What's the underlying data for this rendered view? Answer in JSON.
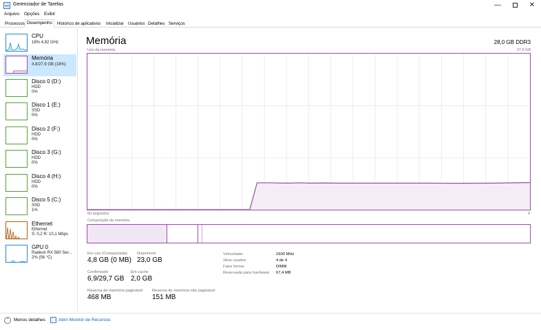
{
  "window": {
    "title": "Gerenciador de Tarefas",
    "minimize": "—",
    "close": "✕"
  },
  "menu": [
    "Arquivo",
    "Opções",
    "Exibir"
  ],
  "tabs": [
    {
      "label": "Processos",
      "active": false
    },
    {
      "label": "Desempenho",
      "active": true
    },
    {
      "label": "Histórico de aplicativos",
      "active": false
    },
    {
      "label": "Inicializar",
      "active": false
    },
    {
      "label": "Usuários",
      "active": false
    },
    {
      "label": "Detalhes",
      "active": false
    },
    {
      "label": "Serviços",
      "active": false
    }
  ],
  "sidebar": [
    {
      "title": "CPU",
      "sub": [
        "18% 4,82 GHz"
      ],
      "color": "#1f8ad6"
    },
    {
      "title": "Memória",
      "sub": [
        "4,8/27,9 GB (18%)"
      ],
      "color": "#9b4aa8"
    },
    {
      "title": "Disco 0 (D:)",
      "sub": [
        "HDD",
        "0%"
      ],
      "color": "#4ca52f"
    },
    {
      "title": "Disco 1 (E:)",
      "sub": [
        "SSD",
        "0%"
      ],
      "color": "#4ca52f"
    },
    {
      "title": "Disco 2 (F:)",
      "sub": [
        "HDD",
        "0%"
      ],
      "color": "#4ca52f"
    },
    {
      "title": "Disco 3 (G:)",
      "sub": [
        "HDD",
        "0%"
      ],
      "color": "#4ca52f"
    },
    {
      "title": "Disco 4 (H:)",
      "sub": [
        "HDD",
        "0%"
      ],
      "color": "#4ca52f"
    },
    {
      "title": "Disco 5 (C:)",
      "sub": [
        "SSD",
        "1%"
      ],
      "color": "#4ca52f"
    },
    {
      "title": "Ethernet",
      "sub": [
        "Ethernet",
        "S: 0,2 R: 10,1 Mbps"
      ],
      "color": "#a65f10"
    },
    {
      "title": "GPU 0",
      "sub": [
        "Radeon RX 580 Ser...",
        "2% (56 °C)"
      ],
      "color": "#1f8ad6"
    }
  ],
  "main": {
    "title": "Memória",
    "capacity": "28,0 GB DDR3",
    "chart_label": "Uso da memória",
    "chart_max": "27,9 GB",
    "time_left": "60 segundos",
    "time_right": "0",
    "composition_label": "Composição da memória"
  },
  "chart_data": {
    "type": "area",
    "title": "Uso da memória",
    "x_label_left": "60 segundos",
    "x_label_right": "0",
    "y_max_label": "27,9 GB",
    "ylim": [
      0,
      27.9
    ],
    "grid": true,
    "color": "#9b4aa8",
    "series": [
      {
        "x": [
          60,
          38,
          37,
          35,
          33,
          31,
          30,
          28,
          26,
          20,
          14,
          10,
          5,
          0
        ],
        "values": [
          0,
          0,
          4.8,
          4.8,
          4.75,
          4.8,
          4.75,
          4.78,
          4.75,
          4.75,
          4.75,
          4.72,
          4.75,
          4.85
        ]
      }
    ]
  },
  "composition": {
    "in_use_fraction": 0.18,
    "modified_fraction": 0.07,
    "standby_fraction": 0.01
  },
  "stats": {
    "in_use_label": "Em uso (Compactada)",
    "in_use_value": "4,8 GB (0 MB)",
    "available_label": "Disponível",
    "available_value": "23,0 GB",
    "committed_label": "Confirmado",
    "committed_value": "6,9/29,7 GB",
    "cached_label": "Em cache",
    "cached_value": "2,0 GB",
    "paged_label": "Reserva de memória paginável",
    "paged_value": "468 MB",
    "nonpaged_label": "Reserva de memória não paginável",
    "nonpaged_value": "151 MB"
  },
  "specs": {
    "speed_label": "Velocidade:",
    "speed_value": "1600 MHz",
    "slots_label": "Slots usados:",
    "slots_value": "4 de 4",
    "form_label": "Fator forma:",
    "form_value": "DIMM",
    "reserved_label": "Reservada para hardware:",
    "reserved_value": "67,4 MB"
  },
  "footer": {
    "less_details": "Menos detalhes",
    "resource_monitor": "Abrir Monitor de Recursos"
  }
}
